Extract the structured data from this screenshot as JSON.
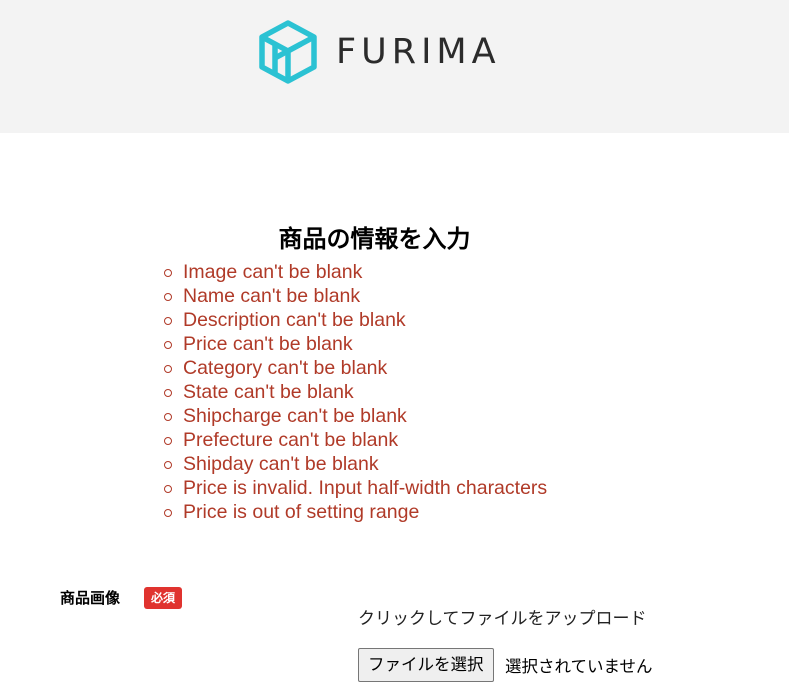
{
  "header": {
    "logo_text": "FURIMA",
    "logo_icon": "box-icon",
    "background": "#f3f3f3",
    "accent": "#2bc2d3"
  },
  "main": {
    "title": "商品の情報を入力",
    "errors": [
      "Image can't be blank",
      "Name can't be blank",
      "Description can't be blank",
      "Price can't be blank",
      "Category can't be blank",
      "State can't be blank",
      "Shipcharge can't be blank",
      "Prefecture can't be blank",
      "Shipday can't be blank",
      "Price is invalid. Input half-width characters",
      "Price is out of setting range"
    ],
    "error_color": "#b03a28"
  },
  "image_field": {
    "label": "商品画像",
    "required_badge": "必須",
    "badge_color": "#e0332f",
    "upload_hint": "クリックしてファイルをアップロード",
    "file_button_label": "ファイルを選択",
    "file_status": "選択されていません"
  }
}
